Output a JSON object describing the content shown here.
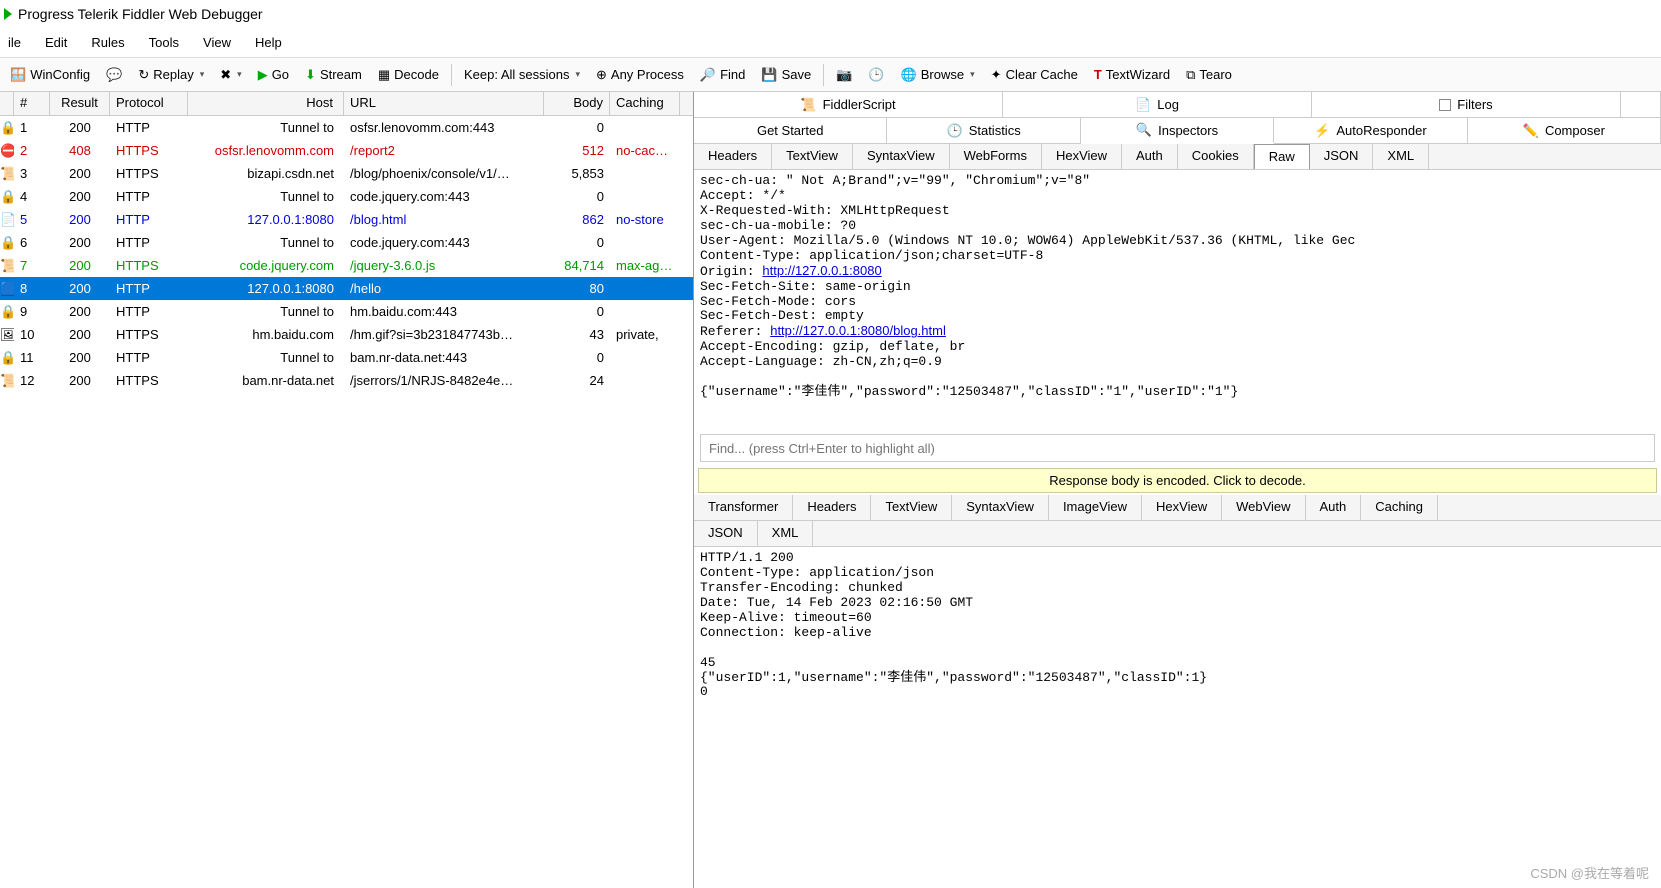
{
  "title": "Progress Telerik Fiddler Web Debugger",
  "menu": [
    "ile",
    "Edit",
    "Rules",
    "Tools",
    "View",
    "Help"
  ],
  "toolbar": {
    "winconfig": "WinConfig",
    "replay": "Replay",
    "go": "Go",
    "stream": "Stream",
    "decode": "Decode",
    "keep": "Keep: All sessions",
    "anyprocess": "Any Process",
    "find": "Find",
    "save": "Save",
    "browse": "Browse",
    "clearcache": "Clear Cache",
    "textwizard": "TextWizard",
    "tearoff": "Tearo"
  },
  "grid": {
    "headers": {
      "id": "#",
      "result": "Result",
      "protocol": "Protocol",
      "host": "Host",
      "url": "URL",
      "body": "Body",
      "caching": "Caching"
    },
    "rows": [
      {
        "icon": "🔒",
        "id": "1",
        "result": "200",
        "protocol": "HTTP",
        "host": "Tunnel to",
        "url": "osfsr.lenovomm.com:443",
        "body": "0",
        "caching": "",
        "style": ""
      },
      {
        "icon": "⛔",
        "id": "2",
        "result": "408",
        "protocol": "HTTPS",
        "host": "osfsr.lenovomm.com",
        "url": "/report2",
        "body": "512",
        "caching": "no-cac…",
        "style": "error"
      },
      {
        "icon": "📜",
        "id": "3",
        "result": "200",
        "protocol": "HTTPS",
        "host": "bizapi.csdn.net",
        "url": "/blog/phoenix/console/v1/…",
        "body": "5,853",
        "caching": "",
        "style": ""
      },
      {
        "icon": "🔒",
        "id": "4",
        "result": "200",
        "protocol": "HTTP",
        "host": "Tunnel to",
        "url": "code.jquery.com:443",
        "body": "0",
        "caching": "",
        "style": ""
      },
      {
        "icon": "📄",
        "id": "5",
        "result": "200",
        "protocol": "HTTP",
        "host": "127.0.0.1:8080",
        "url": "/blog.html",
        "body": "862",
        "caching": "no-store",
        "style": "blue"
      },
      {
        "icon": "🔒",
        "id": "6",
        "result": "200",
        "protocol": "HTTP",
        "host": "Tunnel to",
        "url": "code.jquery.com:443",
        "body": "0",
        "caching": "",
        "style": ""
      },
      {
        "icon": "📜",
        "id": "7",
        "result": "200",
        "protocol": "HTTPS",
        "host": "code.jquery.com",
        "url": "/jquery-3.6.0.js",
        "body": "84,714",
        "caching": "max-ag…",
        "style": "green"
      },
      {
        "icon": "🟦",
        "id": "8",
        "result": "200",
        "protocol": "HTTP",
        "host": "127.0.0.1:8080",
        "url": "/hello",
        "body": "80",
        "caching": "",
        "style": "selected"
      },
      {
        "icon": "🔒",
        "id": "9",
        "result": "200",
        "protocol": "HTTP",
        "host": "Tunnel to",
        "url": "hm.baidu.com:443",
        "body": "0",
        "caching": "",
        "style": ""
      },
      {
        "icon": "🖼",
        "id": "10",
        "result": "200",
        "protocol": "HTTPS",
        "host": "hm.baidu.com",
        "url": "/hm.gif?si=3b231847743b…",
        "body": "43",
        "caching": "private,",
        "style": ""
      },
      {
        "icon": "🔒",
        "id": "11",
        "result": "200",
        "protocol": "HTTP",
        "host": "Tunnel to",
        "url": "bam.nr-data.net:443",
        "body": "0",
        "caching": "",
        "style": ""
      },
      {
        "icon": "📜",
        "id": "12",
        "result": "200",
        "protocol": "HTTPS",
        "host": "bam.nr-data.net",
        "url": "/jserrors/1/NRJS-8482e4e…",
        "body": "24",
        "caching": "",
        "style": ""
      }
    ]
  },
  "right": {
    "top_tabs": [
      {
        "icon": "📜",
        "label": "FiddlerScript"
      },
      {
        "icon": "📄",
        "label": "Log"
      },
      {
        "icon": "☐",
        "label": "Filters"
      }
    ],
    "second_tabs": [
      {
        "icon": "",
        "label": "Get Started"
      },
      {
        "icon": "🕒",
        "label": "Statistics"
      },
      {
        "icon": "🔍",
        "label": "Inspectors",
        "active": true
      },
      {
        "icon": "⚡",
        "label": "AutoResponder"
      },
      {
        "icon": "✏️",
        "label": "Composer"
      }
    ],
    "req_tabs": [
      "Headers",
      "TextView",
      "SyntaxView",
      "WebForms",
      "HexView",
      "Auth",
      "Cookies",
      "Raw",
      "JSON",
      "XML"
    ],
    "req_active": "Raw",
    "req_raw": "sec-ch-ua: \" Not A;Brand\";v=\"99\", \"Chromium\";v=\"8\"\nAccept: */*\nX-Requested-With: XMLHttpRequest\nsec-ch-ua-mobile: ?0\nUser-Agent: Mozilla/5.0 (Windows NT 10.0; WOW64) AppleWebKit/537.36 (KHTML, like Gec\nContent-Type: application/json;charset=UTF-8\nOrigin: http://127.0.0.1:8080\nSec-Fetch-Site: same-origin\nSec-Fetch-Mode: cors\nSec-Fetch-Dest: empty\nReferer: http://127.0.0.1:8080/blog.html\nAccept-Encoding: gzip, deflate, br\nAccept-Language: zh-CN,zh;q=0.9\n\n{\"username\":\"李佳伟\",\"password\":\"12503487\",\"classID\":\"1\",\"userID\":\"1\"}",
    "find_placeholder": "Find... (press Ctrl+Enter to highlight all)",
    "decode_notice": "Response body is encoded. Click to decode.",
    "resp_tabs": [
      "Transformer",
      "Headers",
      "TextView",
      "SyntaxView",
      "ImageView",
      "HexView",
      "WebView",
      "Auth",
      "Caching"
    ],
    "resp_tabs2": [
      "JSON",
      "XML"
    ],
    "resp_raw": "HTTP/1.1 200\nContent-Type: application/json\nTransfer-Encoding: chunked\nDate: Tue, 14 Feb 2023 02:16:50 GMT\nKeep-Alive: timeout=60\nConnection: keep-alive\n\n45\n{\"userID\":1,\"username\":\"李佳伟\",\"password\":\"12503487\",\"classID\":1}\n0"
  },
  "watermark": "CSDN @我在等着呢"
}
